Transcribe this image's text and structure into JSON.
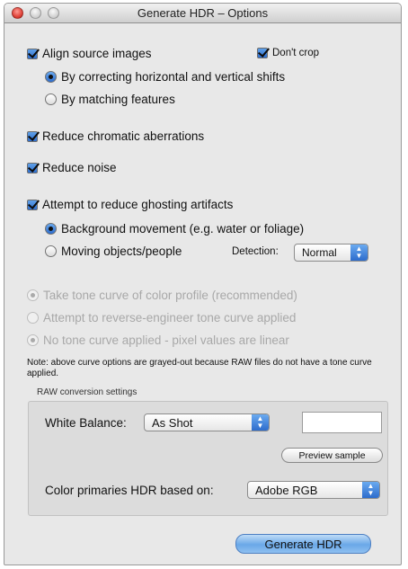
{
  "window": {
    "title": "Generate HDR – Options"
  },
  "align": {
    "label": "Align source images",
    "dont_crop": "Don't crop",
    "options": [
      {
        "label": "By correcting horizontal and vertical shifts"
      },
      {
        "label": "By matching features"
      }
    ]
  },
  "chromatic": {
    "label": "Reduce chromatic aberrations"
  },
  "noise": {
    "label": "Reduce noise"
  },
  "ghosting": {
    "label": "Attempt to reduce ghosting artifacts",
    "options": [
      {
        "label": "Background movement (e.g. water or foliage)"
      },
      {
        "label": "Moving objects/people"
      }
    ],
    "detection_label": "Detection:",
    "detection_value": "Normal"
  },
  "tone": {
    "options": [
      {
        "label": "Take tone curve of color profile  (recommended)"
      },
      {
        "label": "Attempt to reverse-engineer tone curve applied"
      },
      {
        "label": "No tone curve applied - pixel values are linear"
      }
    ],
    "note": "Note: above curve options are grayed-out because RAW files do not have a tone curve applied."
  },
  "raw": {
    "group_title": "RAW conversion settings",
    "white_balance_label": "White Balance:",
    "white_balance_value": "As Shot",
    "preview_label": "Preview sample",
    "primaries_label": "Color primaries HDR based on:",
    "primaries_value": "Adobe RGB"
  },
  "actions": {
    "generate_label": "Generate HDR"
  }
}
